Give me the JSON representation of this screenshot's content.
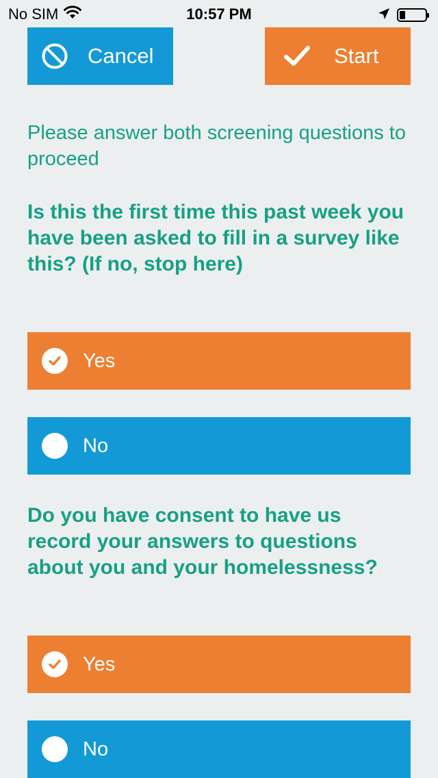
{
  "status_bar": {
    "carrier": "No SIM",
    "time": "10:57 PM",
    "icons": [
      "wifi-icon",
      "location-arrow-icon",
      "battery-icon"
    ]
  },
  "header": {
    "cancel_label": "Cancel",
    "start_label": "Start",
    "cancel_icon": "prohibited-icon",
    "start_icon": "checkmark-icon"
  },
  "content": {
    "instructions": "Please answer both screening questions to proceed",
    "questions": [
      {
        "text": "Is this the first time this past week you have been asked to fill in a survey like this? (If no, stop here)",
        "options": [
          {
            "label": "Yes",
            "selected": true
          },
          {
            "label": "No",
            "selected": false
          }
        ]
      },
      {
        "text": "Do you have consent to have us record your answers to questions about you and your homelessness?",
        "options": [
          {
            "label": "Yes",
            "selected": true
          },
          {
            "label": "No",
            "selected": false
          }
        ]
      }
    ]
  },
  "colors": {
    "background": "#ECEFF0",
    "text_green": "#17A084",
    "accent_orange": "#EC7F32",
    "accent_blue": "#139AD6"
  }
}
